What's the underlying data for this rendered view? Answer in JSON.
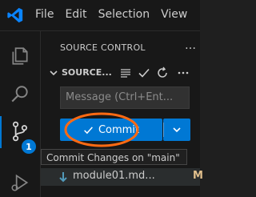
{
  "menu": [
    "File",
    "Edit",
    "Selection",
    "View"
  ],
  "activity": {
    "badge_count": "1",
    "icons": [
      "explorer-icon",
      "search-icon",
      "source-control-icon",
      "run-debug-icon"
    ]
  },
  "sidebar": {
    "header": "SOURCE CONTROL",
    "more": "…",
    "section_title": "SOURCE...",
    "message_placeholder": "Message (Ctrl+Ent...",
    "commit_label": "Commit",
    "tooltip": "Commit Changes on \"main\"",
    "file": {
      "name": "module01.md...",
      "status": "M"
    }
  },
  "colors": {
    "accent": "#0078d4",
    "annotation": "#ff6a13",
    "modified": "#e2c08d"
  }
}
